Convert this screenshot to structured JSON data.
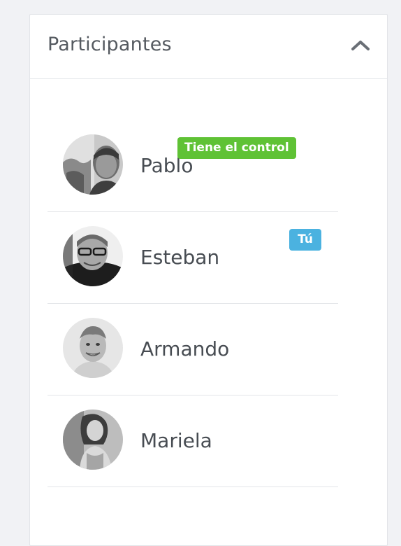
{
  "panel": {
    "title": "Participantes",
    "collapse_icon": "chevron-up-icon"
  },
  "participants": [
    {
      "name": "Pablo",
      "badge": "Tiene el control",
      "badge_color": "#5fc235",
      "avatar": "avatar-photo"
    },
    {
      "name": "Esteban",
      "badge": "Tú",
      "badge_color": "#4bb2e0",
      "avatar": "avatar-photo"
    },
    {
      "name": "Armando",
      "badge": "",
      "avatar": "avatar-photo"
    },
    {
      "name": "Mariela",
      "badge": "",
      "avatar": "avatar-photo"
    }
  ],
  "colors": {
    "page_background": "#f1f2f5",
    "panel_background": "#ffffff",
    "title_text": "#555a60",
    "name_text": "#474c52",
    "control_badge": "#5fc235",
    "you_badge": "#4bb2e0"
  }
}
